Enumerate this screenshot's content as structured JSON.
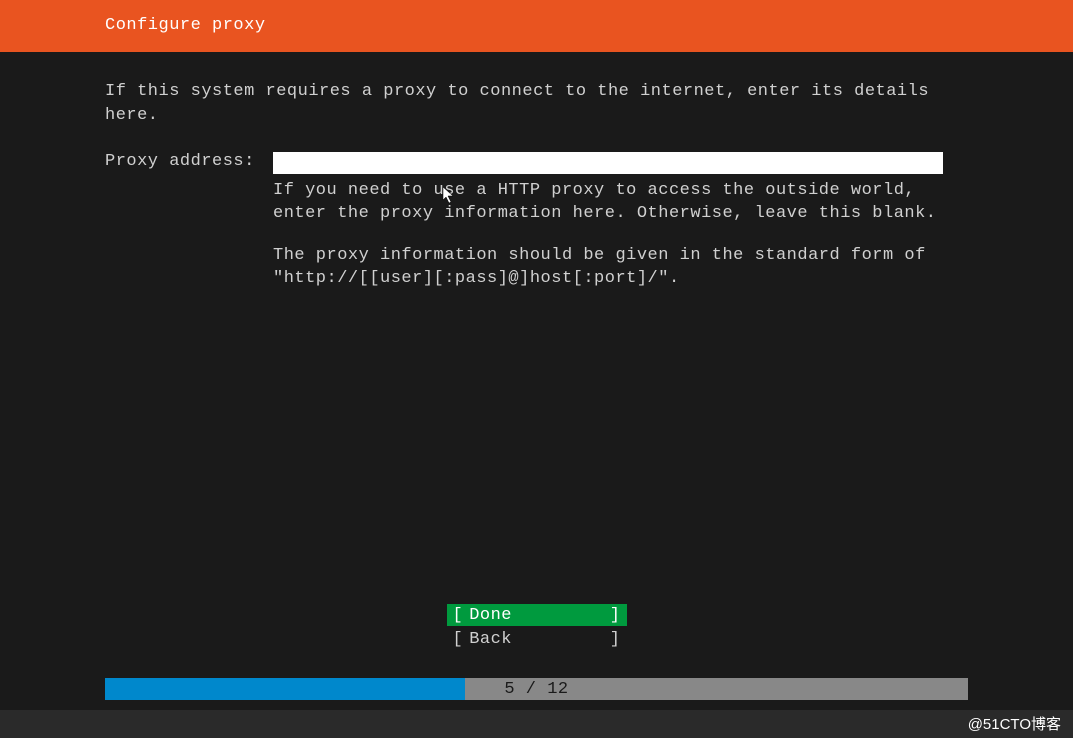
{
  "header": {
    "title": "Configure proxy"
  },
  "content": {
    "intro": "If this system requires a proxy to connect to the internet, enter its details here.",
    "form": {
      "proxy_label": "Proxy address:",
      "proxy_value": "",
      "help1": "If you need to use a HTTP proxy to access the outside world, enter the proxy information here. Otherwise, leave this blank.",
      "help2": "The proxy information should be given in the standard form of \"http://[[user][:pass]@]host[:port]/\"."
    }
  },
  "buttons": {
    "done": "Done",
    "back": "Back"
  },
  "progress": {
    "current": 5,
    "total": 12,
    "text": "5 / 12",
    "percent": 41.67
  },
  "watermark": "@51CTO博客",
  "brackets": {
    "left": "[",
    "right": "]"
  }
}
